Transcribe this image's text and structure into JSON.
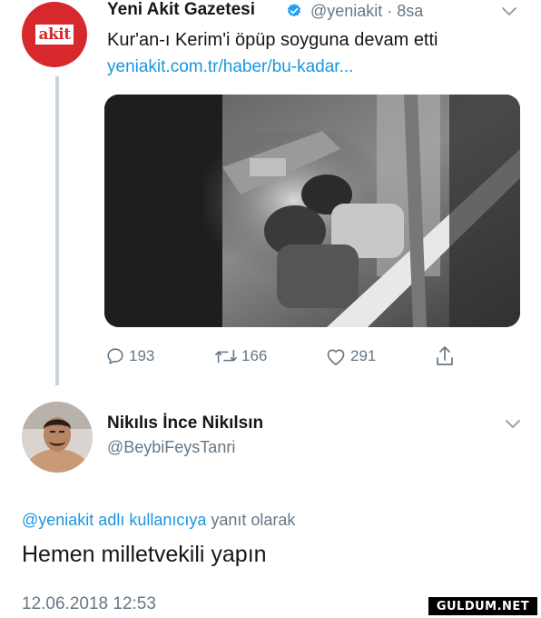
{
  "tweet": {
    "author_name": "Yeni Akit Gazetesi",
    "handle_time": "@yeniakit · 8sa",
    "avatar_logo": "akit",
    "text": "Kur'an-ı Kerim'i öpüp soyguna devam etti",
    "link": "yeniakit.com.tr/haber/bu-kadar...",
    "actions": {
      "reply_count": "193",
      "retweet_count": "166",
      "like_count": "291"
    }
  },
  "reply": {
    "author_name": "Nikılıs İnce Nikılsın",
    "handle": "@BeybiFeysTanri",
    "replying_mention": "@yeniakit adlı kullanıcıya",
    "replying_suffix": " yanıt olarak",
    "text": "Hemen milletvekili yapın",
    "timestamp": "12.06.2018 12:53"
  },
  "watermark": "GULDUM.NET",
  "colors": {
    "link_blue": "#1b95e0",
    "muted_gray": "#657786",
    "akit_red": "#d7282c"
  },
  "icons": [
    "verified-badge-icon",
    "chevron-down-icon",
    "reply-icon",
    "retweet-icon",
    "like-icon",
    "share-icon"
  ]
}
